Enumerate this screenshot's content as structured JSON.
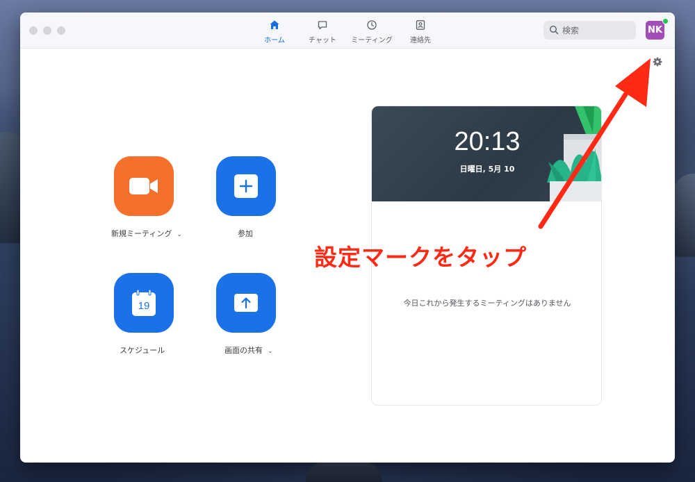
{
  "app": {
    "tabs": [
      {
        "id": "home",
        "label": "ホーム",
        "icon": "home-icon",
        "active": true
      },
      {
        "id": "chat",
        "label": "チャット",
        "icon": "chat-icon",
        "active": false
      },
      {
        "id": "meeting",
        "label": "ミーティング",
        "icon": "clock-icon",
        "active": false
      },
      {
        "id": "contacts",
        "label": "連絡先",
        "icon": "contact-icon",
        "active": false
      }
    ],
    "search": {
      "placeholder": "検索"
    },
    "avatar": {
      "initials": "NK",
      "status_color": "#23c552"
    }
  },
  "actions": {
    "new_meeting": {
      "label": "新規ミーティング",
      "icon": "video-camera-icon",
      "color": "#f5712b",
      "has_dropdown": true
    },
    "join": {
      "label": "参加",
      "icon": "plus-icon",
      "color": "#1a71e8"
    },
    "schedule": {
      "label": "スケジュール",
      "icon": "calendar-icon",
      "calendar_day": "19",
      "color": "#1a71e8"
    },
    "share_screen": {
      "label": "画面の共有",
      "icon": "share-up-arrow-icon",
      "color": "#1a71e8",
      "has_dropdown": true
    }
  },
  "card": {
    "time": "20:13",
    "date": "日曜日, 5月 10",
    "empty_message": "今日これから発生するミーティングはありません"
  },
  "annotation": {
    "text": "設定マークをタップ",
    "color": "#ff2a15"
  }
}
